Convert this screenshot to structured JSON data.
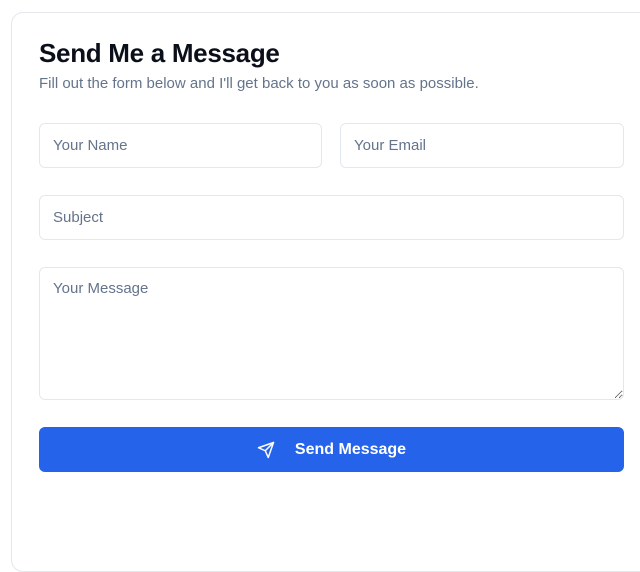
{
  "form": {
    "title": "Send Me a Message",
    "subtitle": "Fill out the form below and I'll get back to you as soon as possible.",
    "name_placeholder": "Your Name",
    "email_placeholder": "Your Email",
    "subject_placeholder": "Subject",
    "message_placeholder": "Your Message",
    "submit_label": "Send Message",
    "submit_icon": "send-icon"
  },
  "colors": {
    "accent": "#2563eb",
    "title": "#0b0f1a",
    "muted": "#64748b",
    "border": "#e2e8f0"
  }
}
